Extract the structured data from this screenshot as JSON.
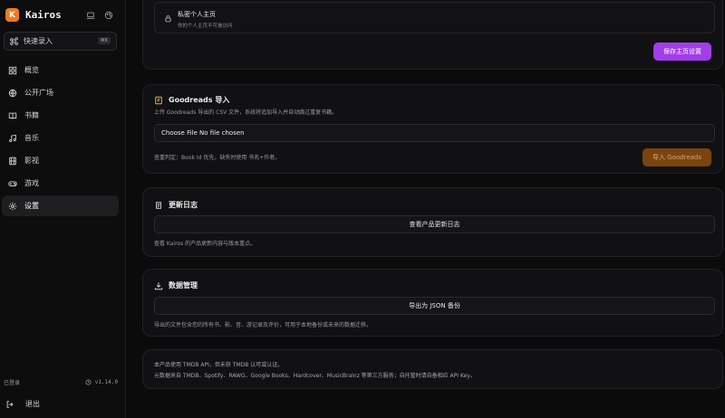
{
  "app": {
    "name": "Kairos",
    "logo_letter": "K",
    "accent": "#f07a1e"
  },
  "sidebar": {
    "quick_entry": {
      "label": "快速录入",
      "shortcut": "⌘K"
    },
    "items": [
      {
        "label": "概览",
        "icon": "grid-icon"
      },
      {
        "label": "公开广场",
        "icon": "globe-icon"
      },
      {
        "label": "书籍",
        "icon": "book-icon"
      },
      {
        "label": "音乐",
        "icon": "music-icon"
      },
      {
        "label": "影视",
        "icon": "film-icon"
      },
      {
        "label": "游戏",
        "icon": "gamepad-icon"
      },
      {
        "label": "设置",
        "icon": "gear-icon",
        "active": true
      }
    ],
    "status": "已登录",
    "version": "v1.14.0",
    "logout": "退出"
  },
  "profile_card": {
    "privacy_title": "私密个人主页",
    "privacy_desc": "你的个人主页不可被访问",
    "save_button": "保存主页设置",
    "save_color": "#a23ee8"
  },
  "goodreads": {
    "title": "Goodreads 导入",
    "description": "上传 Goodreads 导出的 CSV 文件，系统将追加导入并自动跳过重复书籍。",
    "file_input": "Choose File No file chosen",
    "note": "查重判定：Book Id 优先，缺失时使用 书名+作者。",
    "import_button": "导入 Goodreads"
  },
  "changelog": {
    "title": "更新日志",
    "button": "查看产品更新日志",
    "description": "查看 Kairos 的产品更新内容与版本重点。"
  },
  "data_management": {
    "title": "数据管理",
    "button": "导出为 JSON 备份",
    "description": "导出的文件包含您的所有书、影、音、游记录及评价，可用于本地备份或未来的数据迁移。"
  },
  "footer": {
    "line1": "本产品使用 TMDB API，但未获 TMDB 认可或认证。",
    "line2": "元数据来自 TMDB、Spotify、RAWG、Google Books、Hardcover、MusicBrainz 等第三方服务；自托管时请自备相应 API Key。"
  }
}
